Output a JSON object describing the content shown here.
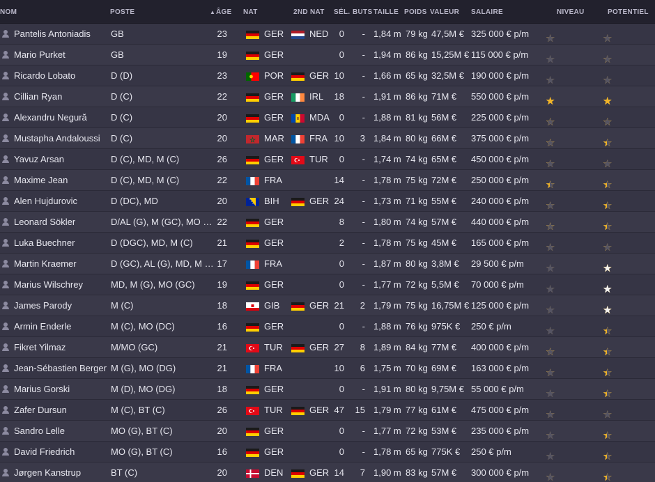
{
  "colors": {
    "header_bg": "#22212d",
    "row_bg": "#363545",
    "row_alt_bg": "#3a3949",
    "text": "#e6e6ee",
    "star_gold": "#f0b429",
    "star_empty": "#555463",
    "star_white": "#f2f2f2"
  },
  "headers": {
    "nom": "NOM",
    "poste": "POSTE",
    "sort_arrow": "▲",
    "age": "ÂGE",
    "nat": "NAT",
    "nat2": "2ND NAT",
    "sel": "SÉL.",
    "buts": "BUTS",
    "taille": "TAILLE",
    "poids": "POIDS",
    "valeur": "VALEUR",
    "salaire": "SALAIRE",
    "niveau": "NIVEAU",
    "potentiel": "POTENTIEL"
  },
  "players": [
    {
      "name": "Pantelis Antoniadis",
      "pos": "GB",
      "age": "23",
      "nat": "GER",
      "nat2": "NED",
      "sel": "0",
      "buts": "-",
      "taille": "1,84 m",
      "poids": "79 kg",
      "valeur": "47,5M €",
      "salaire": "325 000 € p/m",
      "niveau": 3,
      "potentiel": 3
    },
    {
      "name": "Mario Purket",
      "pos": "GB",
      "age": "19",
      "nat": "GER",
      "nat2": "",
      "sel": "0",
      "buts": "-",
      "taille": "1,94 m",
      "poids": "86 kg",
      "valeur": "15,25M €",
      "salaire": "115 000 € p/m",
      "niveau": 2,
      "potentiel": 3.5
    },
    {
      "name": "Ricardo Lobato",
      "pos": "D (D)",
      "age": "23",
      "nat": "POR",
      "nat2": "GER",
      "sel": "10",
      "buts": "-",
      "taille": "1,66 m",
      "poids": "65 kg",
      "valeur": "32,5M €",
      "salaire": "190 000 € p/m",
      "niveau": 2.5,
      "potentiel": 3
    },
    {
      "name": "Cillian Ryan",
      "pos": "D (C)",
      "age": "22",
      "nat": "GER",
      "nat2": "IRL",
      "sel": "18",
      "buts": "-",
      "taille": "1,91 m",
      "poids": "86 kg",
      "valeur": "71M €",
      "salaire": "550 000 € p/m",
      "niveau": 5,
      "potentiel": 5
    },
    {
      "name": "Alexandru Negură",
      "pos": "D (C)",
      "age": "20",
      "nat": "GER",
      "nat2": "MDA",
      "sel": "0",
      "buts": "-",
      "taille": "1,88 m",
      "poids": "81 kg",
      "valeur": "56M €",
      "salaire": "225 000 € p/m",
      "niveau": 4,
      "potentiel": 4
    },
    {
      "name": "Mustapha Andaloussi",
      "pos": "D (C)",
      "age": "20",
      "nat": "MAR",
      "nat2": "FRA",
      "sel": "10",
      "buts": "3",
      "taille": "1,84 m",
      "poids": "80 kg",
      "valeur": "66M €",
      "salaire": "375 000 € p/m",
      "niveau": 4,
      "potentiel": 4.5
    },
    {
      "name": "Yavuz Arsan",
      "pos": "D (C), MD, M (C)",
      "age": "26",
      "nat": "GER",
      "nat2": "TUR",
      "sel": "0",
      "buts": "-",
      "taille": "1,74 m",
      "poids": "74 kg",
      "valeur": "65M €",
      "salaire": "450 000 € p/m",
      "niveau": 3.5,
      "potentiel": 3.5
    },
    {
      "name": "Maxime Jean",
      "pos": "D (C), MD, M (C)",
      "age": "22",
      "nat": "FRA",
      "nat2": "",
      "sel": "14",
      "buts": "-",
      "taille": "1,78 m",
      "poids": "75 kg",
      "valeur": "72M €",
      "salaire": "250 000 € p/m",
      "niveau": 4.5,
      "potentiel": 4.5
    },
    {
      "name": "Alen Hujdurovic",
      "pos": "D (DC), MD",
      "age": "20",
      "nat": "BIH",
      "nat2": "GER",
      "sel": "24",
      "buts": "-",
      "taille": "1,73 m",
      "poids": "71 kg",
      "valeur": "55M €",
      "salaire": "240 000 € p/m",
      "niveau": 3.5,
      "potentiel": 4.5
    },
    {
      "name": "Leonard Sökler",
      "pos": "D/AL (G), M (GC), MO (G)",
      "age": "22",
      "nat": "GER",
      "nat2": "",
      "sel": "8",
      "buts": "-",
      "taille": "1,80 m",
      "poids": "74 kg",
      "valeur": "57M €",
      "salaire": "440 000 € p/m",
      "niveau": 4,
      "potentiel": 4.5
    },
    {
      "name": "Luka Buechner",
      "pos": "D (DGC), MD, M (C)",
      "age": "21",
      "nat": "GER",
      "nat2": "",
      "sel": "2",
      "buts": "-",
      "taille": "1,78 m",
      "poids": "75 kg",
      "valeur": "45M €",
      "salaire": "165 000 € p/m",
      "niveau": 3,
      "potentiel": 3.5
    },
    {
      "name": "Martin Kraemer",
      "pos": "D (GC), AL (G), MD, M (C)",
      "age": "17",
      "nat": "FRA",
      "nat2": "",
      "sel": "0",
      "buts": "-",
      "taille": "1,87 m",
      "poids": "80 kg",
      "valeur": "3,8M €",
      "salaire": "29 500 € p/m",
      "niveau": 2,
      "potentiel": 4,
      "pw": true
    },
    {
      "name": "Marius Wilschrey",
      "pos": "MD, M (G), MO (GC)",
      "age": "19",
      "nat": "GER",
      "nat2": "",
      "sel": "0",
      "buts": "-",
      "taille": "1,77 m",
      "poids": "72 kg",
      "valeur": "5,5M €",
      "salaire": "70 000 € p/m",
      "niveau": 2,
      "potentiel": 3,
      "pw": true
    },
    {
      "name": "James Parody",
      "pos": "M (C)",
      "age": "18",
      "nat": "GIB",
      "nat2": "GER",
      "sel": "21",
      "buts": "2",
      "taille": "1,79 m",
      "poids": "75 kg",
      "valeur": "16,75M €",
      "salaire": "125 000 € p/m",
      "niveau": 2.5,
      "potentiel": 4,
      "pw": true
    },
    {
      "name": "Armin Enderle",
      "pos": "M (C), MO (DC)",
      "age": "16",
      "nat": "GER",
      "nat2": "",
      "sel": "0",
      "buts": "-",
      "taille": "1,88 m",
      "poids": "76 kg",
      "valeur": "975K €",
      "salaire": "250 € p/m",
      "niveau": 2,
      "potentiel": 4.5
    },
    {
      "name": "Fikret Yilmaz",
      "pos": "M/MO (GC)",
      "age": "21",
      "nat": "TUR",
      "nat2": "GER",
      "sel": "27",
      "buts": "8",
      "taille": "1,89 m",
      "poids": "84 kg",
      "valeur": "77M €",
      "salaire": "400 000 € p/m",
      "niveau": 4,
      "potentiel": 4.5
    },
    {
      "name": "Jean-Sébastien Berger",
      "pos": "M (G), MO (DG)",
      "age": "21",
      "nat": "FRA",
      "nat2": "",
      "sel": "10",
      "buts": "6",
      "taille": "1,75 m",
      "poids": "70 kg",
      "valeur": "69M €",
      "salaire": "163 000 € p/m",
      "niveau": 3.5,
      "potentiel": 4.5
    },
    {
      "name": "Marius Gorski",
      "pos": "M (D), MO (DG)",
      "age": "18",
      "nat": "GER",
      "nat2": "",
      "sel": "0",
      "buts": "-",
      "taille": "1,91 m",
      "poids": "80 kg",
      "valeur": "9,75M €",
      "salaire": "55 000 € p/m",
      "niveau": 2,
      "potentiel": 4.5
    },
    {
      "name": "Zafer Dursun",
      "pos": "M (C), BT (C)",
      "age": "26",
      "nat": "TUR",
      "nat2": "GER",
      "sel": "47",
      "buts": "15",
      "taille": "1,79 m",
      "poids": "77 kg",
      "valeur": "61M €",
      "salaire": "475 000 € p/m",
      "niveau": 3,
      "potentiel": 3
    },
    {
      "name": "Sandro Lelle",
      "pos": "MO (G), BT (C)",
      "age": "20",
      "nat": "GER",
      "nat2": "",
      "sel": "0",
      "buts": "-",
      "taille": "1,77 m",
      "poids": "72 kg",
      "valeur": "53M €",
      "salaire": "235 000 € p/m",
      "niveau": 2.5,
      "potentiel": 4.5
    },
    {
      "name": "David Friedrich",
      "pos": "MO (G), BT (C)",
      "age": "16",
      "nat": "GER",
      "nat2": "",
      "sel": "0",
      "buts": "-",
      "taille": "1,78 m",
      "poids": "65 kg",
      "valeur": "775K €",
      "salaire": "250 € p/m",
      "niveau": 2,
      "potentiel": 4.5
    },
    {
      "name": "Jørgen Kanstrup",
      "pos": "BT (C)",
      "age": "20",
      "nat": "DEN",
      "nat2": "GER",
      "sel": "14",
      "buts": "7",
      "taille": "1,90 m",
      "poids": "83 kg",
      "valeur": "57M €",
      "salaire": "300 000 € p/m",
      "niveau": 3,
      "potentiel": 4.5
    }
  ]
}
